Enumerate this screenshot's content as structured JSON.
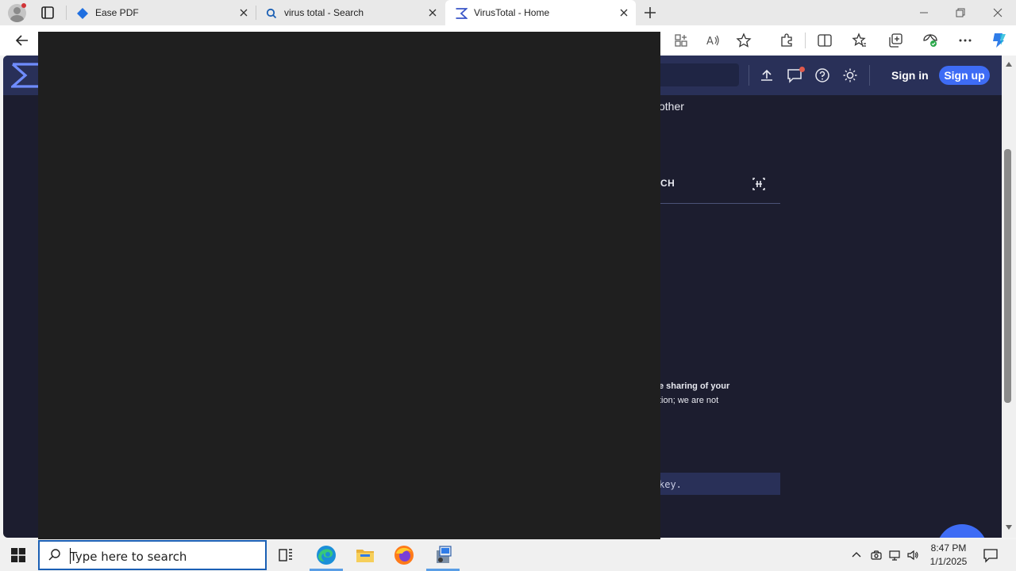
{
  "browser": {
    "tabs": [
      {
        "title": "Ease PDF",
        "icon": "ease-pdf-diamond-icon",
        "active": false
      },
      {
        "title": "virus total - Search",
        "icon": "search-icon",
        "active": false
      },
      {
        "title": "VirusTotal - Home",
        "icon": "virustotal-logo-icon",
        "active": true
      }
    ],
    "accent": "#0078d4"
  },
  "virustotal": {
    "header": {
      "sign_in": "Sign in",
      "sign_up": "Sign up",
      "bg_color": "#293058",
      "button_color": "#3e6cf5"
    },
    "fragments": {
      "other": "other",
      "ch": "CH",
      "sharing": "e sharing of your",
      "tion": "tion; we are not",
      "key": "key."
    }
  },
  "taskbar": {
    "search_placeholder": "Type here to search",
    "time": "8:47 PM",
    "date": "1/1/2025"
  }
}
